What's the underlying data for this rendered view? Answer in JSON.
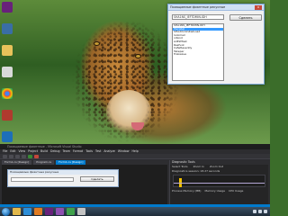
{
  "dialog": {
    "title": "Поиащаемые фиантные рекусные",
    "search_placeholder": "",
    "search_value": "SHA1NS_IEFTDMIN-IDH",
    "button_label": "Сделать",
    "close_label": "x",
    "list_items": [
      "SHA1NS_IEFTDMIN-IDH",
      "iSerabel",
      "SHA2CLSInitialLoad",
      "lookmail",
      "nitAnd",
      "AdEWTest",
      "Resfvok",
      "CafwResently",
      "Takeper",
      "Trakwave"
    ],
    "selected_index": 1
  },
  "vs": {
    "title": "Поиащаемые фиантные - Microsoft Visual Studio",
    "menus": [
      "File",
      "Edit",
      "View",
      "Project",
      "Build",
      "Debug",
      "Team",
      "Format",
      "Tools",
      "Test",
      "Analyze",
      "Window",
      "Help"
    ],
    "tabs": [
      "Form1.cs [Design]",
      "Program.cs",
      "Form1.cs [Design]"
    ],
    "active_tab_index": 2,
    "inner_form_title": "Поиащаемые фиантные рекусные",
    "inner_form_button": "Сделать",
    "diag_title": "Diagnostic Tools",
    "diag_select_tools": "Select Tools",
    "diag_zoom_in": "Zoom In",
    "diag_zoom_out": "Zoom Out",
    "diag_session": "Diagnostics session: 18.27 seconds",
    "diag_memory": "Process Memory (MB)",
    "diag_mem_usage": "Memory Usage",
    "diag_cpu_usage": "CPU Usage"
  },
  "colors": {
    "vs_bg": "#2d2d30",
    "vs_accent": "#007acc",
    "selection": "#3399ff"
  },
  "icons": {
    "desktop": [
      "visual-studio-icon",
      "computer-icon",
      "folder-icon",
      "notepad-icon",
      "chrome-icon",
      "app-icon",
      "app-icon",
      "floppy-icon",
      "app-icon"
    ],
    "taskbar": [
      "explorer-icon",
      "ie-icon",
      "media-player-icon",
      "visual-studio-icon",
      "visual-studio-icon",
      "task-manager-icon",
      "app-icon"
    ]
  }
}
